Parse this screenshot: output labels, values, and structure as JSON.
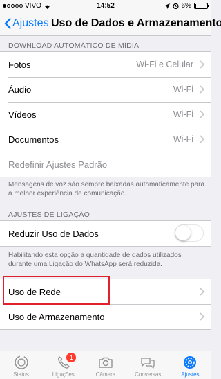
{
  "status_bar": {
    "carrier": "VIVO",
    "time": "14:52",
    "battery": "6%",
    "battery_level": 0.06
  },
  "nav": {
    "back_label": "Ajustes",
    "title": "Uso de Dados e Armazenamento"
  },
  "auto_download": {
    "header": "DOWNLOAD AUTOMÁTICO DE MÍDIA",
    "rows": [
      {
        "label": "Fotos",
        "value": "Wi-Fi e Celular"
      },
      {
        "label": "Áudio",
        "value": "Wi-Fi"
      },
      {
        "label": "Vídeos",
        "value": "Wi-Fi"
      },
      {
        "label": "Documentos",
        "value": "Wi-Fi"
      },
      {
        "label": "Redefinir Ajustes Padrão"
      }
    ],
    "footer": "Mensagens de voz são sempre baixadas automaticamente para a melhor experiência de comunicação."
  },
  "call_settings": {
    "header": "AJUSTES DE LIGAÇÃO",
    "low_data_label": "Reduzir Uso de Dados",
    "low_data_enabled": false,
    "footer": "Habilitando esta opção a quantidade de dados utilizados durante uma Ligação do WhatsApp será reduzida."
  },
  "usage": {
    "network_label": "Uso de Rede",
    "storage_label": "Uso de Armazenamento"
  },
  "tabs": [
    {
      "label": "Status",
      "icon": "status-icon"
    },
    {
      "label": "Ligações",
      "icon": "phone-icon",
      "badge": "1"
    },
    {
      "label": "Câmera",
      "icon": "camera-icon"
    },
    {
      "label": "Conversas",
      "icon": "chat-icon"
    },
    {
      "label": "Ajustes",
      "icon": "gear-icon",
      "active": true
    }
  ],
  "colors": {
    "accent": "#0a7aff",
    "highlight": "#e0202a",
    "badge": "#ff3b30"
  }
}
